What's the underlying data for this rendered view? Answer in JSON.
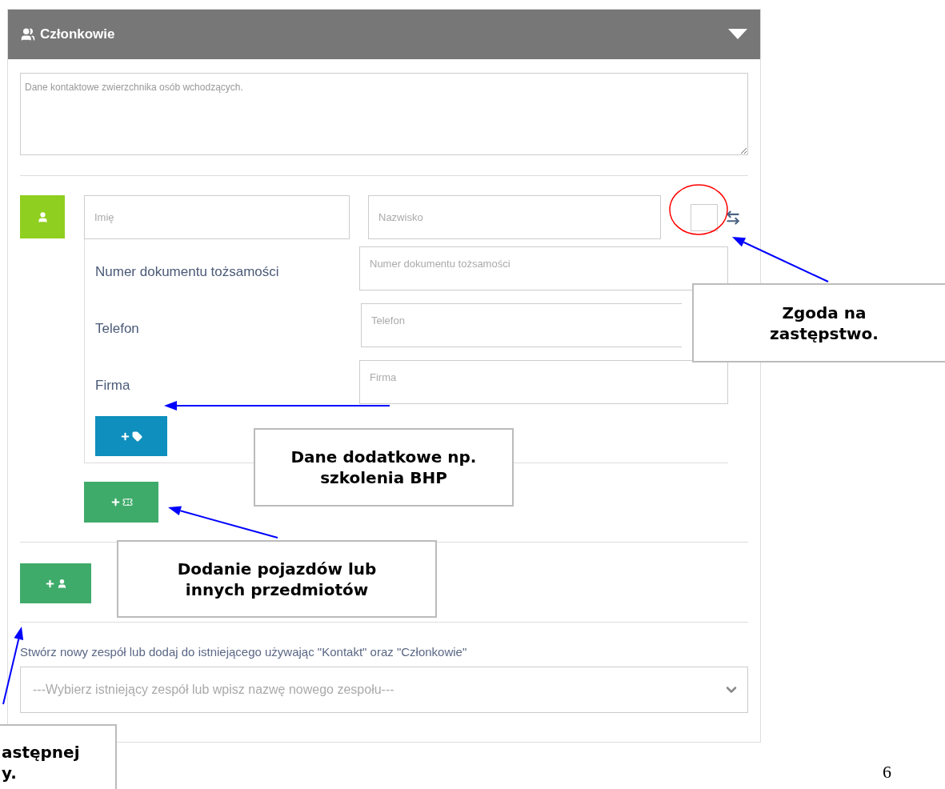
{
  "panel": {
    "title": "Członkowie"
  },
  "description": {
    "placeholder": "Dane kontaktowe zwierzchnika osób wchodzących."
  },
  "member": {
    "first_name": {
      "placeholder": "Imię"
    },
    "last_name": {
      "placeholder": "Nazwisko"
    },
    "substitution": {
      "checked": false
    },
    "fields": [
      {
        "label": "Numer dokumentu tożsamości",
        "placeholder": "Numer dokumentu tożsamości"
      },
      {
        "label": "Telefon",
        "placeholder": "Telefon"
      },
      {
        "label": "Firma",
        "placeholder": "Firma"
      }
    ]
  },
  "team": {
    "label": "Stwórz nowy zespół lub dodaj do istniejącego używając \"Kontakt\" oraz \"Członkowie\"",
    "placeholder": "---Wybierz istniejący zespół lub wpisz nazwę nowego zespołu---"
  },
  "callouts": [
    {
      "lines": [
        "Zgoda na",
        "zastępstwo."
      ]
    },
    {
      "lines": [
        "Dane dodatkowe np.",
        "szkolenia BHP"
      ]
    },
    {
      "lines": [
        "Dodanie pojazdów lub",
        "innych przedmiotów"
      ]
    },
    {
      "lines": [
        "astępnej",
        "y."
      ]
    }
  ],
  "page_number": "6"
}
